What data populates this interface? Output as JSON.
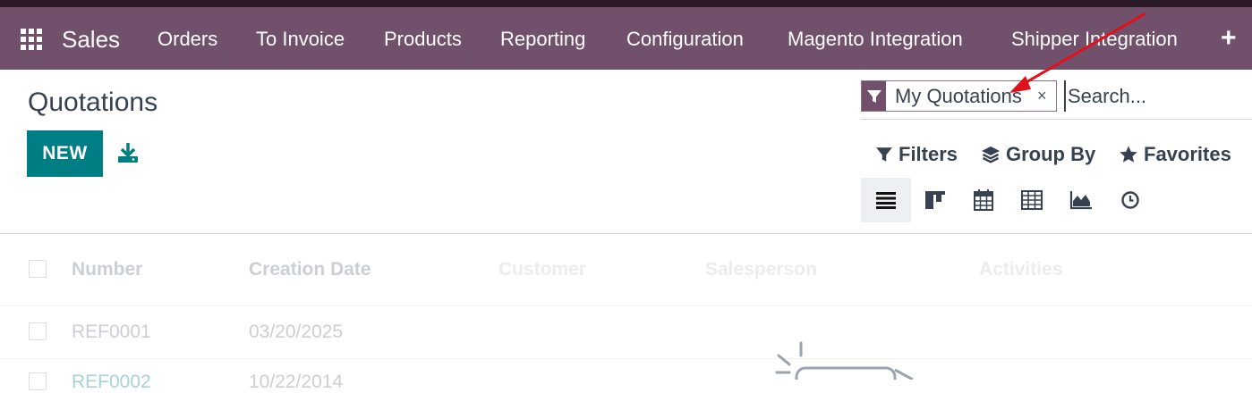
{
  "navbar": {
    "brand": "Sales",
    "menu": [
      "Orders",
      "To Invoice",
      "Products",
      "Reporting",
      "Configuration",
      "Magento Integration",
      "Shipper Integration"
    ],
    "more": "+"
  },
  "page": {
    "title": "Quotations",
    "new_label": "NEW"
  },
  "search": {
    "facet_label": "My Quotations",
    "facet_close": "×",
    "placeholder": "Search..."
  },
  "filters": {
    "filters_label": "Filters",
    "group_by_label": "Group By",
    "favorites_label": "Favorites"
  },
  "views": [
    "list-view-icon",
    "kanban-view-icon",
    "calendar-view-icon",
    "pivot-view-icon",
    "graph-view-icon",
    "activity-view-icon"
  ],
  "table": {
    "columns": [
      "Number",
      "Creation Date",
      "Customer",
      "Salesperson",
      "Activities"
    ],
    "rows": [
      {
        "number": "REF0001",
        "date": "03/20/2025"
      },
      {
        "number": "REF0002",
        "date": "10/22/2014"
      }
    ]
  },
  "colors": {
    "navbar": "#71506b",
    "primary_button": "#017e84",
    "annotation_arrow": "#e3101a"
  }
}
